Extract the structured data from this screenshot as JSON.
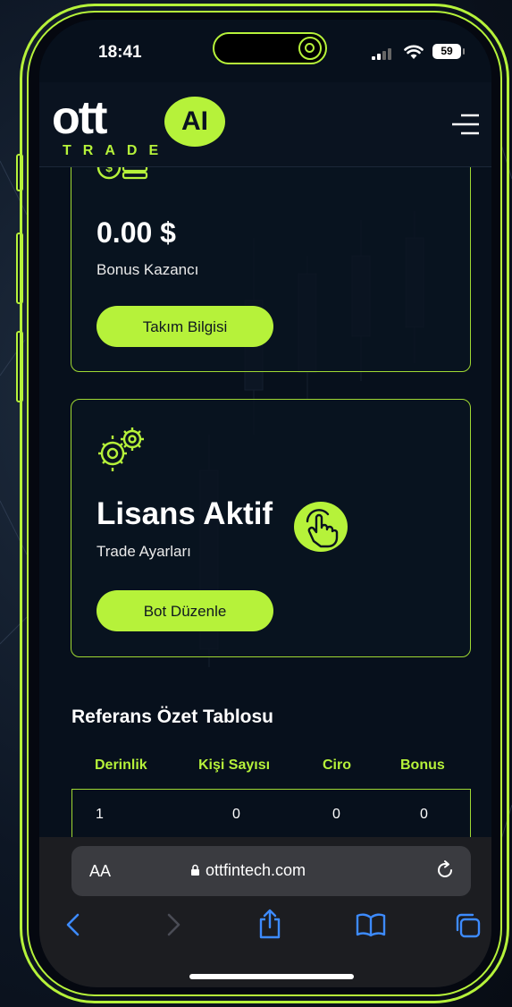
{
  "status_bar": {
    "time": "18:41",
    "battery": "59"
  },
  "header": {
    "logo_text": "ott",
    "logo_sub": "TRADE",
    "logo_badge": "AI"
  },
  "bonus_card": {
    "amount": "0.00 $",
    "label": "Bonus Kazancı",
    "button": "Takım Bilgisi",
    "icon": "money-stack-icon"
  },
  "license_card": {
    "title": "Lisans Aktif",
    "label": "Trade Ayarları",
    "button": "Bot Düzenle",
    "icon": "gears-icon"
  },
  "referral": {
    "title": "Referans Özet Tablosu",
    "columns": [
      "Derinlik",
      "Kişi Sayısı",
      "Ciro",
      "Bonus"
    ],
    "rows": [
      [
        "1",
        "0",
        "0",
        "0"
      ]
    ]
  },
  "browser": {
    "aa": "AA",
    "url": "ottfintech.com"
  },
  "colors": {
    "accent": "#b6f23a",
    "background": "#07101c"
  }
}
